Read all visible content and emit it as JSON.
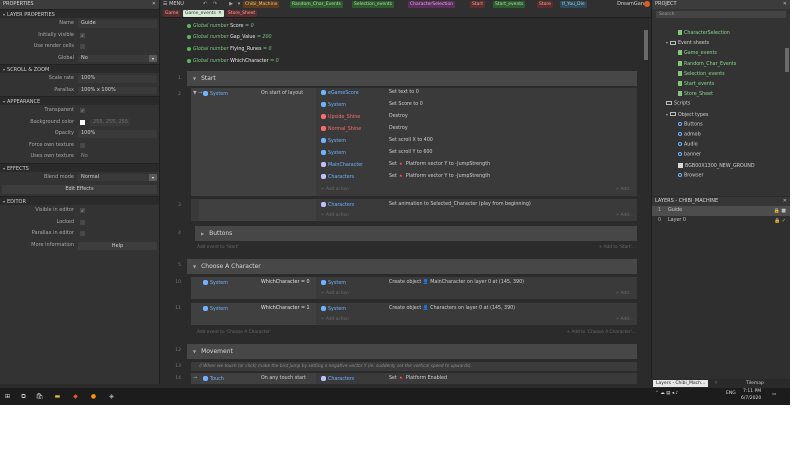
{
  "properties": {
    "title": "PROPERTIES",
    "sections": {
      "layer": "LAYER PROPERTIES",
      "scroll": "SCROLL & ZOOM",
      "appearance": "APPEARANCE",
      "effects": "EFFECTS",
      "editor": "EDITOR"
    },
    "name_label": "Name",
    "name_value": "Guide",
    "initially_visible_label": "Initially visible",
    "use_render_cells_label": "Use render cells",
    "global_label": "Global",
    "global_value": "No",
    "scale_rate_label": "Scale rate",
    "scale_rate_value": "100%",
    "parallax_label": "Parallax",
    "parallax_value": "100% x 100%",
    "transparent_label": "Transparent",
    "bg_color_label": "Background color",
    "bg_color_value": "255, 255, 255",
    "opacity_label": "Opacity",
    "opacity_value": "100%",
    "force_own_texture_label": "Force own texture",
    "uses_own_texture_label": "Uses own texture",
    "uses_own_texture_value": "No",
    "blend_mode_label": "Blend mode",
    "blend_mode_value": "Normal",
    "edit_effects_label": "Edit Effects",
    "visible_in_editor_label": "Visible in editor",
    "locked_label": "Locked",
    "parallax_in_editor_label": "Parallax in editor",
    "more_info_label": "More information",
    "help_label": "Help"
  },
  "topbar": {
    "menu_label": "☰ MENU",
    "tabs_row1": [
      {
        "label": "Chibi_Machine",
        "bg": "#5a3b1e",
        "fg": "#f0c080"
      },
      {
        "label": "Random_Char_Events",
        "bg": "#2e5a2e",
        "fg": "#a8e0a8"
      },
      {
        "label": "Selection_events",
        "bg": "#2e5a2e",
        "fg": "#a8e0a8"
      },
      {
        "label": "CharacterSelection",
        "bg": "#5a2e5a",
        "fg": "#e0a8e0"
      },
      {
        "label": "Start",
        "bg": "#5a2e2e",
        "fg": "#f0a0a0"
      },
      {
        "label": "Start_events",
        "bg": "#2e5a2e",
        "fg": "#a8e0a8"
      },
      {
        "label": "Store",
        "bg": "#5a2e2e",
        "fg": "#f0a0a0"
      },
      {
        "label": "If_You_Die",
        "bg": "#2e4a5a",
        "fg": "#a8d0e0"
      }
    ],
    "tabs_row2": [
      {
        "label": "Game",
        "bg": "#5a2e2e",
        "fg": "#f0a0a0"
      },
      {
        "label": "Game_events",
        "bg": "#d8e8d8",
        "fg": "#1e3e1e",
        "active": true
      },
      {
        "label": "Store_Sheet",
        "bg": "#5a2e2e",
        "fg": "#f0a0a0"
      }
    ],
    "user": "DreamGan"
  },
  "sheet": {
    "globals": [
      {
        "prefix": "Global number ",
        "name": "Score",
        "suffix": " = 0"
      },
      {
        "prefix": "Global number ",
        "name": "Gap_Value",
        "suffix": " = 200"
      },
      {
        "prefix": "Global number ",
        "name": "Flying_Runes",
        "suffix": " = 0"
      },
      {
        "prefix": "Global number ",
        "name": "WhichCharacter",
        "suffix": " = 0"
      }
    ],
    "row_numbers": [
      "1",
      "2",
      "3",
      "4",
      "5",
      "10",
      "11",
      "12",
      "13",
      "14"
    ],
    "group_start": "Start",
    "event_system": "System",
    "event_on_start": "On start of layout",
    "actions_start": [
      {
        "obj": "eGameScore",
        "cls": "sys",
        "text": "Set text to 0",
        "ic": "#6fb2ff"
      },
      {
        "obj": "System",
        "cls": "sys",
        "text": "Set Score to 0",
        "ic": "#6fb2ff"
      },
      {
        "obj": "Upside_Shine",
        "cls": "obj-red",
        "text": "Destroy",
        "ic": "#ff6b6b"
      },
      {
        "obj": "Normal_Shine",
        "cls": "obj-red",
        "text": "Destroy",
        "ic": "#ff6b6b"
      },
      {
        "obj": "System",
        "cls": "sys",
        "text": "Set scroll X to 400",
        "ic": "#6fb2ff"
      },
      {
        "obj": "System",
        "cls": "sys",
        "text": "Set scroll Y to 600",
        "ic": "#6fb2ff"
      },
      {
        "obj": "MainCharacter",
        "cls": "sys",
        "text": "Set 🔺 Platform vector Y to -JumpStrength",
        "ic": "#c0c0ff"
      },
      {
        "obj": "Characters",
        "cls": "sys",
        "text": "Set 🔺 Platform vector Y to -JumpStrength",
        "ic": "#c0c0ff"
      }
    ],
    "add_action": "+ Add action",
    "add_short": "+ Add...",
    "subevent_obj": "Characters",
    "subevent_action": "Set animation to Selected_Character (play from beginning)",
    "group_buttons": "Buttons",
    "add_event_start": "Add event to 'Start'",
    "add_to_start": "+ Add to 'Start'...",
    "group_choose": "Choose A Character",
    "choose_rows": [
      {
        "cond": "WhichCharacter = 0",
        "action": "Create object 👤 MainCharacter on layer 0 at (145, 390)"
      },
      {
        "cond": "WhichCharacter = 1",
        "action": "Create object 👤 Characters on layer 0 at (145, 390)"
      }
    ],
    "add_event_choose": "Add event to 'Choose A Character'",
    "add_to_choose": "+ Add to 'Choose A Character'...",
    "group_movement": "Movement",
    "movement_comment": "// When we touch (or click) make the bird jump by setting a negative vector Y (ie. suddenly set the vertical speed to upwards).",
    "touch_obj": "Touch",
    "touch_cond": "On any touch start",
    "touch_act_obj": "Characters",
    "touch_act": "Set 🔺 Platform Enabled"
  },
  "project": {
    "title": "PROJECT",
    "search_placeholder": "Search",
    "items": [
      {
        "label": "CharacterSelection",
        "type": "file",
        "indent": 26,
        "hl": true
      },
      {
        "label": "Event sheets",
        "type": "folder",
        "indent": 14,
        "hl": false,
        "arrow": true
      },
      {
        "label": "Game_events",
        "type": "file",
        "indent": 26,
        "hl": true
      },
      {
        "label": "Random_Char_Events",
        "type": "file",
        "indent": 26,
        "hl": true
      },
      {
        "label": "Selection_events",
        "type": "file",
        "indent": 26,
        "hl": true
      },
      {
        "label": "Start_events",
        "type": "file",
        "indent": 26,
        "hl": true
      },
      {
        "label": "Store_Sheet",
        "type": "file",
        "indent": 26,
        "hl": true
      },
      {
        "label": "Scripts",
        "type": "folder",
        "indent": 14,
        "hl": false,
        "arrow": false
      },
      {
        "label": "Object types",
        "type": "folder",
        "indent": 14,
        "hl": false,
        "arrow": true
      },
      {
        "label": "Buttons",
        "type": "obj",
        "indent": 26,
        "hl": false
      },
      {
        "label": "admob",
        "type": "obj",
        "indent": 26,
        "hl": false
      },
      {
        "label": "Audio",
        "type": "obj",
        "indent": 26,
        "hl": false
      },
      {
        "label": "banner",
        "type": "obj",
        "indent": 26,
        "hl": false
      },
      {
        "label": "BGB00X1300_NEW_GROUND",
        "type": "img",
        "indent": 26,
        "hl": false
      },
      {
        "label": "Browser",
        "type": "obj",
        "indent": 26,
        "hl": false
      }
    ]
  },
  "layers": {
    "title": "LAYERS - CHIBI_MACHINE",
    "rows": [
      {
        "num": "1",
        "name": "Guide",
        "icons": "🔒 ■",
        "selected": true
      },
      {
        "num": "0",
        "name": "Layer 0",
        "icons": "🔒 ✓",
        "selected": false
      }
    ]
  },
  "bottom_tabs": {
    "layers_tab": "Layers - Chibi_Mach...",
    "tilemap_tab": "Tilemap"
  },
  "taskbar": {
    "lang": "ENG",
    "time": "7:11 PM",
    "date": "6/7/2020"
  }
}
